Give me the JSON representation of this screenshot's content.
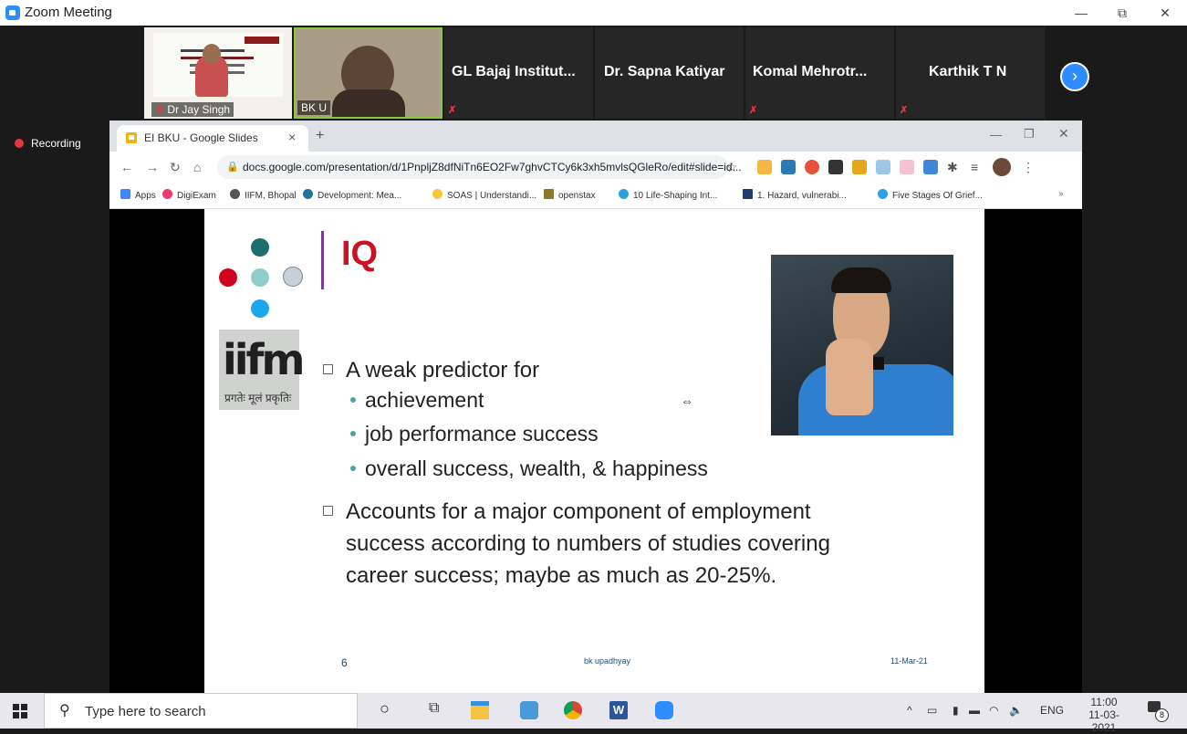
{
  "window": {
    "title": "Zoom Meeting",
    "minimize_icon": "—",
    "maximize_icon": "⧉",
    "close_icon": "✕"
  },
  "participants": [
    {
      "name": "Dr Jay Singh"
    },
    {
      "name": "BK U"
    },
    {
      "name": "GL Bajaj Institut..."
    },
    {
      "name": "Dr. Sapna Katiyar"
    },
    {
      "name": "Komal Mehrotr..."
    },
    {
      "name": "Karthik T N"
    }
  ],
  "recording": "Recording",
  "browser": {
    "tab_title": "EI BKU - Google Slides",
    "url": "docs.google.com/presentation/d/1PnpljZ8dfNiTn6EO2Fw7ghvCTCy6k3xh5mvlsQGleRo/edit#slide=id...",
    "bookmarks": [
      "Apps",
      "DigiExam",
      "IIFM, Bhopal",
      "Development: Mea...",
      "SOAS | Understandi...",
      "openstax",
      "10 Life-Shaping Int...",
      "1. Hazard, vulnerabi...",
      "Five Stages Of Grief..."
    ]
  },
  "slide": {
    "title": "IQ",
    "logo_text": "iifm",
    "logo_sub": "प्रगतेः मूलं प्रकृतिः",
    "bullet1": "A weak predictor for",
    "subbullets": [
      "achievement",
      "job performance success",
      "overall success, wealth, & happiness"
    ],
    "bullet2": "Accounts for a major component of employment success according to numbers of studies covering career success; maybe as much as 20-25%.",
    "page_number": "6",
    "author": "bk upadhyay",
    "date": "11-Mar-21"
  },
  "taskbar": {
    "search_placeholder": "Type here to search",
    "language": "ENG",
    "time": "11:00",
    "date": "11-03-2021",
    "notifications": "8"
  },
  "colors": {
    "zoom_blue": "#2D8CFF",
    "title_red": "#cc1122",
    "accent_purple": "#7e3a9a"
  }
}
